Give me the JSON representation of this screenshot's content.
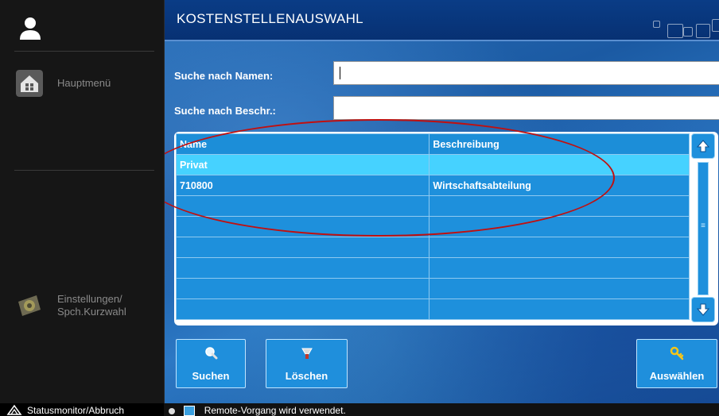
{
  "sidebar": {
    "items": [
      {
        "label": "Hauptmenü",
        "icon": "home-icon"
      },
      {
        "label": "Einstellungen/\nSpch.Kurzwahl",
        "icon": "settings-icon"
      }
    ],
    "user_icon": "user-icon"
  },
  "window": {
    "title": "KOSTENSTELLENAUSWAHL"
  },
  "search": {
    "name_label": "Suche nach Namen:",
    "name_value": "",
    "desc_label": "Suche nach Beschr.:",
    "desc_value": ""
  },
  "table": {
    "columns": [
      "Name",
      "Beschreibung"
    ],
    "rows": [
      {
        "name": "Privat",
        "desc": "",
        "selected": true
      },
      {
        "name": "710800",
        "desc": "Wirtschaftsabteilung",
        "selected": false
      },
      {
        "name": "",
        "desc": "",
        "selected": false
      },
      {
        "name": "",
        "desc": "",
        "selected": false
      },
      {
        "name": "",
        "desc": "",
        "selected": false
      },
      {
        "name": "",
        "desc": "",
        "selected": false
      },
      {
        "name": "",
        "desc": "",
        "selected": false
      },
      {
        "name": "",
        "desc": "",
        "selected": false
      }
    ]
  },
  "buttons": {
    "search": "Suchen",
    "clear": "Löschen",
    "select": "Auswählen"
  },
  "status": {
    "monitor": "Statusmonitor/Abbruch",
    "message": "Remote-Vorgang wird verwendet."
  },
  "colors": {
    "accent": "#1e90dc",
    "selected_row": "#46d2ff",
    "title_bar": "#0a3c86",
    "annotation": "#c01010"
  }
}
